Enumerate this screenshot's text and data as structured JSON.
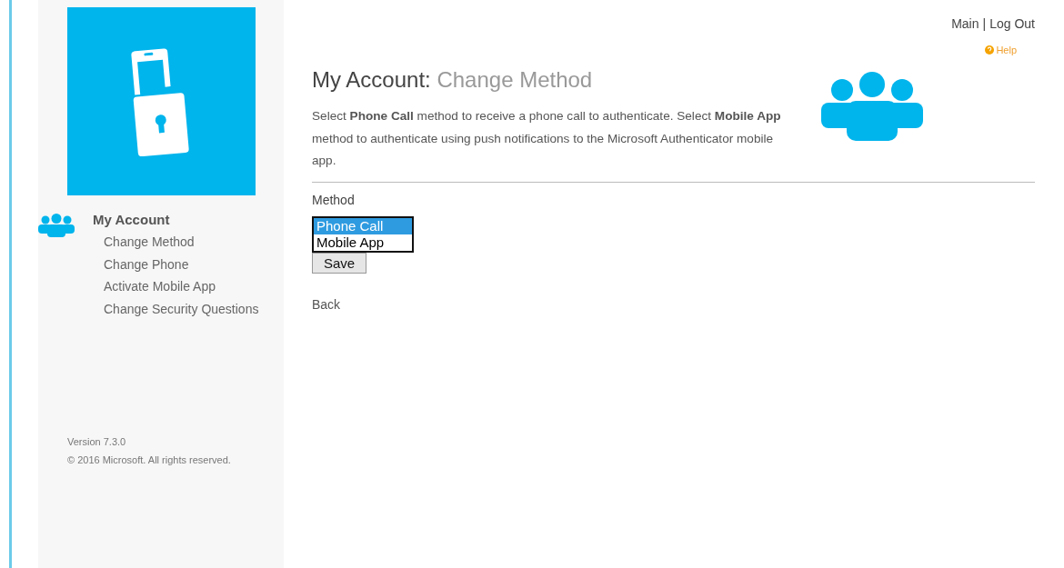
{
  "top_links": {
    "main": "Main",
    "separator": "|",
    "logout": "Log Out"
  },
  "help": "Help",
  "heading": {
    "prefix": "My Account:",
    "title": "Change Method"
  },
  "description": "Select **Phone Call** method to receive a phone call to authenticate. Select **Mobile App** method to authenticate using push notifications to the Microsoft Authenticator mobile app.",
  "method": {
    "label": "Method",
    "options": [
      {
        "label": "Phone Call",
        "selected": true
      },
      {
        "label": "Mobile App",
        "selected": false
      }
    ]
  },
  "save_button": "Save",
  "back_link": "Back",
  "sidebar": {
    "section": "My Account",
    "items": [
      {
        "label": "Change Method"
      },
      {
        "label": "Change Phone"
      },
      {
        "label": "Activate Mobile App"
      },
      {
        "label": "Change Security Questions"
      }
    ],
    "version": "Version 7.3.0",
    "copyright": "© 2016 Microsoft. All rights reserved."
  }
}
